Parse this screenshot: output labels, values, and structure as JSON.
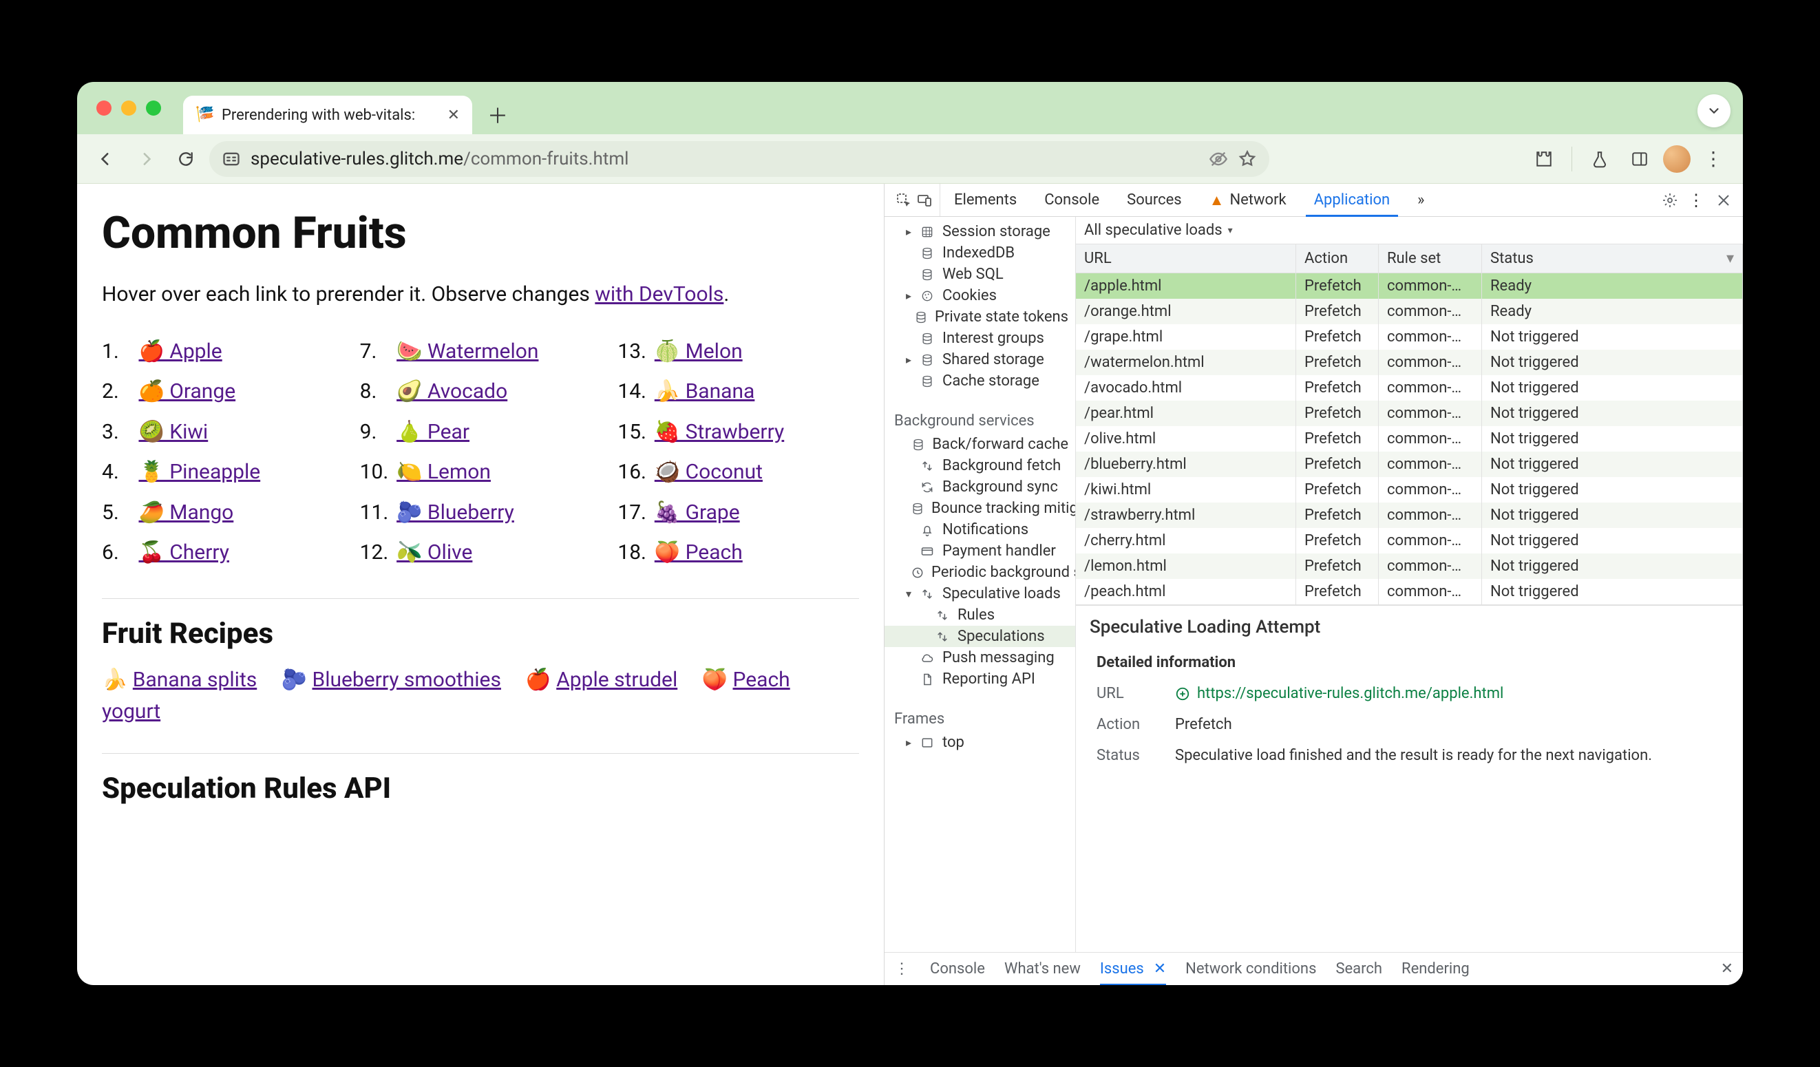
{
  "browser": {
    "tab_title": "Prerendering with web-vitals:",
    "url_host": "speculative-rules.glitch.me",
    "url_path": "/common-fruits.html"
  },
  "page": {
    "h1": "Common Fruits",
    "subtitle_pre": "Hover over each link to prerender it. Observe changes ",
    "subtitle_link": "with DevTools",
    "subtitle_post": ".",
    "fruits": [
      {
        "n": "1.",
        "emoji": "🍎",
        "label": "Apple"
      },
      {
        "n": "2.",
        "emoji": "🍊",
        "label": "Orange"
      },
      {
        "n": "3.",
        "emoji": "🥝",
        "label": "Kiwi"
      },
      {
        "n": "4.",
        "emoji": "🍍",
        "label": "Pineapple"
      },
      {
        "n": "5.",
        "emoji": "🥭",
        "label": "Mango"
      },
      {
        "n": "6.",
        "emoji": "🍒",
        "label": "Cherry"
      },
      {
        "n": "7.",
        "emoji": "🍉",
        "label": "Watermelon"
      },
      {
        "n": "8.",
        "emoji": "🥑",
        "label": "Avocado"
      },
      {
        "n": "9.",
        "emoji": "🍐",
        "label": "Pear"
      },
      {
        "n": "10.",
        "emoji": "🍋",
        "label": "Lemon"
      },
      {
        "n": "11.",
        "emoji": "🫐",
        "label": "Blueberry"
      },
      {
        "n": "12.",
        "emoji": "🫒",
        "label": "Olive"
      },
      {
        "n": "13.",
        "emoji": "🍈",
        "label": "Melon"
      },
      {
        "n": "14.",
        "emoji": "🍌",
        "label": "Banana"
      },
      {
        "n": "15.",
        "emoji": "🍓",
        "label": "Strawberry"
      },
      {
        "n": "16.",
        "emoji": "🥥",
        "label": "Coconut"
      },
      {
        "n": "17.",
        "emoji": "🍇",
        "label": "Grape"
      },
      {
        "n": "18.",
        "emoji": "🍑",
        "label": "Peach"
      }
    ],
    "recipes_h2": "Fruit Recipes",
    "recipes": [
      {
        "emoji": "🍌",
        "label": "Banana splits"
      },
      {
        "emoji": "🫐",
        "label": "Blueberry smoothies"
      },
      {
        "emoji": "🍎",
        "label": "Apple strudel"
      },
      {
        "emoji": "🍑",
        "label": "Peach yogurt"
      }
    ],
    "api_h2": "Speculation Rules API"
  },
  "devtools": {
    "tabs": [
      "Elements",
      "Console",
      "Sources",
      "Network",
      "Application"
    ],
    "network_warn": true,
    "more": "»",
    "filter": "All speculative loads",
    "side_storage": [
      {
        "label": "Session storage",
        "icon": "grid",
        "tw": "▸",
        "lvl": 2
      },
      {
        "label": "IndexedDB",
        "icon": "db",
        "lvl": 2
      },
      {
        "label": "Web SQL",
        "icon": "db",
        "lvl": 2
      },
      {
        "label": "Cookies",
        "icon": "cookie",
        "tw": "▸",
        "lvl": 2
      },
      {
        "label": "Private state tokens",
        "icon": "db",
        "lvl": 2
      },
      {
        "label": "Interest groups",
        "icon": "db",
        "lvl": 2
      },
      {
        "label": "Shared storage",
        "icon": "db",
        "tw": "▸",
        "lvl": 2
      },
      {
        "label": "Cache storage",
        "icon": "db",
        "lvl": 2
      }
    ],
    "bg_header": "Background services",
    "side_bg": [
      {
        "label": "Back/forward cache",
        "icon": "db"
      },
      {
        "label": "Background fetch",
        "icon": "updown"
      },
      {
        "label": "Background sync",
        "icon": "sync"
      },
      {
        "label": "Bounce tracking mitigation",
        "icon": "db"
      },
      {
        "label": "Notifications",
        "icon": "bell"
      },
      {
        "label": "Payment handler",
        "icon": "card"
      },
      {
        "label": "Periodic background sync",
        "icon": "clock"
      },
      {
        "label": "Speculative loads",
        "icon": "updown",
        "tw": "▾"
      },
      {
        "label": "Rules",
        "icon": "updown",
        "lvl": 3
      },
      {
        "label": "Speculations",
        "icon": "updown",
        "lvl": 3,
        "selected": true
      },
      {
        "label": "Push messaging",
        "icon": "cloud"
      },
      {
        "label": "Reporting API",
        "icon": "doc"
      }
    ],
    "frames_header": "Frames",
    "frames": [
      {
        "label": "top",
        "icon": "frame",
        "tw": "▸"
      }
    ],
    "table": {
      "headers": [
        "URL",
        "Action",
        "Rule set",
        "Status"
      ],
      "rows": [
        {
          "url": "/apple.html",
          "action": "Prefetch",
          "ruleset": "common-…",
          "status": "Ready",
          "sel": true
        },
        {
          "url": "/orange.html",
          "action": "Prefetch",
          "ruleset": "common-…",
          "status": "Ready"
        },
        {
          "url": "/grape.html",
          "action": "Prefetch",
          "ruleset": "common-…",
          "status": "Not triggered"
        },
        {
          "url": "/watermelon.html",
          "action": "Prefetch",
          "ruleset": "common-…",
          "status": "Not triggered"
        },
        {
          "url": "/avocado.html",
          "action": "Prefetch",
          "ruleset": "common-…",
          "status": "Not triggered"
        },
        {
          "url": "/pear.html",
          "action": "Prefetch",
          "ruleset": "common-…",
          "status": "Not triggered"
        },
        {
          "url": "/olive.html",
          "action": "Prefetch",
          "ruleset": "common-…",
          "status": "Not triggered"
        },
        {
          "url": "/blueberry.html",
          "action": "Prefetch",
          "ruleset": "common-…",
          "status": "Not triggered"
        },
        {
          "url": "/kiwi.html",
          "action": "Prefetch",
          "ruleset": "common-…",
          "status": "Not triggered"
        },
        {
          "url": "/strawberry.html",
          "action": "Prefetch",
          "ruleset": "common-…",
          "status": "Not triggered"
        },
        {
          "url": "/cherry.html",
          "action": "Prefetch",
          "ruleset": "common-…",
          "status": "Not triggered"
        },
        {
          "url": "/lemon.html",
          "action": "Prefetch",
          "ruleset": "common-…",
          "status": "Not triggered"
        },
        {
          "url": "/peach.html",
          "action": "Prefetch",
          "ruleset": "common-…",
          "status": "Not triggered"
        }
      ]
    },
    "detail": {
      "title": "Speculative Loading Attempt",
      "section": "Detailed information",
      "url_label": "URL",
      "url_value": "https://speculative-rules.glitch.me/apple.html",
      "action_label": "Action",
      "action_value": "Prefetch",
      "status_label": "Status",
      "status_value": "Speculative load finished and the result is ready for the next navigation."
    },
    "drawer": [
      "Console",
      "What's new",
      "Issues",
      "Network conditions",
      "Search",
      "Rendering"
    ],
    "drawer_active": "Issues"
  }
}
